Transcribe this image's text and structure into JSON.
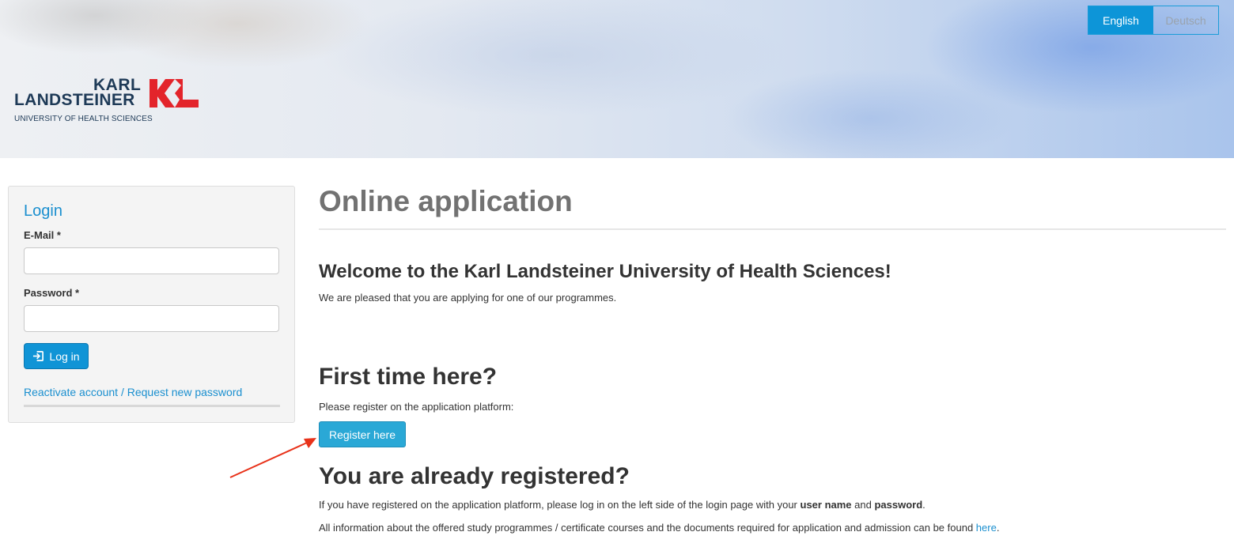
{
  "header": {
    "logo": {
      "line1": "KARL",
      "line2": "LANDSTEINER",
      "subtitle": "UNIVERSITY OF HEALTH SCIENCES",
      "mark": "KL",
      "mark_color": "#e3242b"
    },
    "languages": [
      {
        "label": "English",
        "active": true
      },
      {
        "label": "Deutsch",
        "active": false
      }
    ]
  },
  "login": {
    "title": "Login",
    "email_label": "E-Mail *",
    "email_value": "",
    "password_label": "Password *",
    "password_value": "",
    "submit_icon": "sign-in-icon",
    "submit_label": "Log in",
    "reactivate_link": "Reactivate account / Request new password"
  },
  "main": {
    "title": "Online application",
    "welcome_heading": "Welcome to the Karl Landsteiner University of Health Sciences!",
    "welcome_text": "We are pleased that you are applying for one of our programmes.",
    "first_time_heading": "First time here?",
    "first_time_text": "Please register on the application platform:",
    "register_button": "Register here",
    "registered_heading": "You are already registered?",
    "registered_text": {
      "pre": "If you have registered on the application platform, please log in on the left side of the login page with your ",
      "bold1": "user name",
      "mid": " and ",
      "bold2": "password",
      "post": "."
    },
    "info_text": {
      "pre": "All information about the offered study programmes / certificate courses and the documents required for application and admission can be found ",
      "link": "here",
      "post": "."
    }
  },
  "colors": {
    "accent": "#1094d6",
    "annotation_arrow": "#e8321a"
  }
}
